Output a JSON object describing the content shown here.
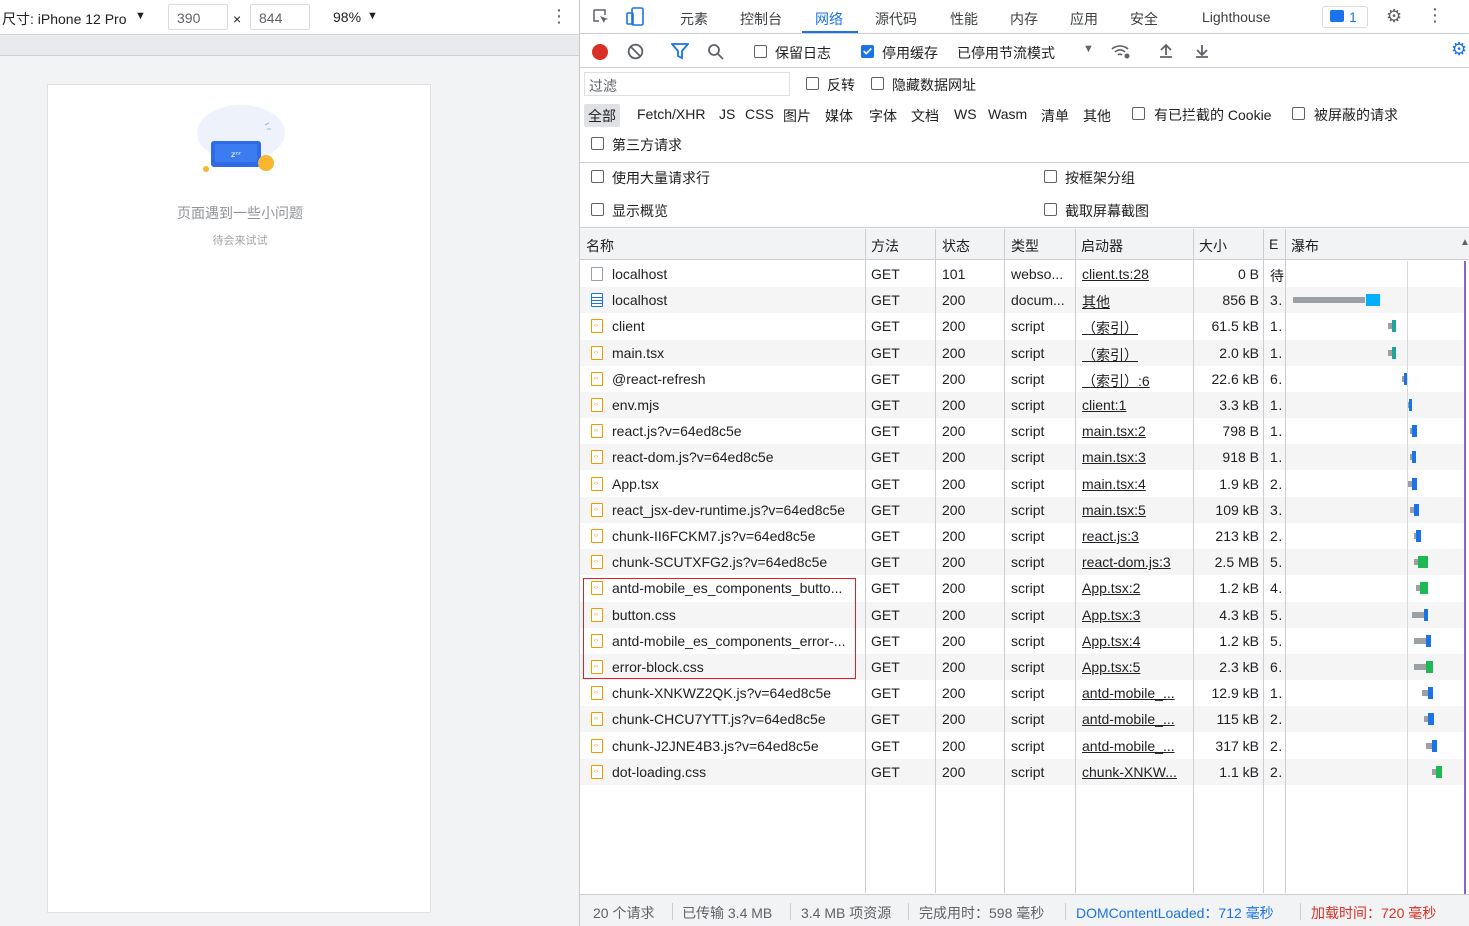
{
  "device_toolbar": {
    "dimension_label": "尺寸: iPhone 12 Pro",
    "width": "390",
    "times": "×",
    "height": "844",
    "zoom": "98%"
  },
  "phone_page": {
    "message": "页面遇到一些小问题",
    "sub_message": "待会来试试",
    "illustration_text": "zᶻᶻ"
  },
  "devtools_tabs": [
    "元素",
    "控制台",
    "网络",
    "源代码",
    "性能",
    "内存",
    "应用",
    "安全",
    "Lighthouse"
  ],
  "active_tab": "网络",
  "issues_count": "1",
  "network_toolbar": {
    "preserve_log": "保留日志",
    "disable_cache": "停用缓存",
    "throttling": "已停用节流模式"
  },
  "filter": {
    "placeholder": "过滤",
    "invert": "反转",
    "hide_data_urls": "隐藏数据网址"
  },
  "type_filters": [
    "全部",
    "Fetch/XHR",
    "JS",
    "CSS",
    "图片",
    "媒体",
    "字体",
    "文档",
    "WS",
    "Wasm",
    "清单",
    "其他"
  ],
  "blocked_cookies": "有已拦截的 Cookie",
  "blocked_requests": "被屏蔽的请求",
  "third_party": "第三方请求",
  "options": {
    "large_rows": "使用大量请求行",
    "group_by_frame": "按框架分组",
    "show_overview": "显示概览",
    "capture_screenshots": "截取屏幕截图"
  },
  "columns": [
    "名称",
    "方法",
    "状态",
    "类型",
    "启动器",
    "大小",
    "E",
    "瀑布"
  ],
  "requests": [
    {
      "name": "localhost",
      "method": "GET",
      "status": "101",
      "type": "webso...",
      "initiator": "client.ts:28",
      "size": "0 B",
      "time": "待",
      "icon": "blank"
    },
    {
      "name": "localhost",
      "method": "GET",
      "status": "200",
      "type": "docum...",
      "initiator": "其他",
      "size": "856 B",
      "time": "3..",
      "icon": "doc"
    },
    {
      "name": "client",
      "method": "GET",
      "status": "200",
      "type": "script",
      "initiator": "（索引）",
      "size": "61.5 kB",
      "time": "1..",
      "icon": "script"
    },
    {
      "name": "main.tsx",
      "method": "GET",
      "status": "200",
      "type": "script",
      "initiator": "（索引）",
      "size": "2.0 kB",
      "time": "1..",
      "icon": "script"
    },
    {
      "name": "@react-refresh",
      "method": "GET",
      "status": "200",
      "type": "script",
      "initiator": "（索引）:6",
      "size": "22.6 kB",
      "time": "6..",
      "icon": "script"
    },
    {
      "name": "env.mjs",
      "method": "GET",
      "status": "200",
      "type": "script",
      "initiator": "client:1",
      "size": "3.3 kB",
      "time": "1..",
      "icon": "script"
    },
    {
      "name": "react.js?v=64ed8c5e",
      "method": "GET",
      "status": "200",
      "type": "script",
      "initiator": "main.tsx:2",
      "size": "798 B",
      "time": "1..",
      "icon": "script"
    },
    {
      "name": "react-dom.js?v=64ed8c5e",
      "method": "GET",
      "status": "200",
      "type": "script",
      "initiator": "main.tsx:3",
      "size": "918 B",
      "time": "1..",
      "icon": "script"
    },
    {
      "name": "App.tsx",
      "method": "GET",
      "status": "200",
      "type": "script",
      "initiator": "main.tsx:4",
      "size": "1.9 kB",
      "time": "2..",
      "icon": "script"
    },
    {
      "name": "react_jsx-dev-runtime.js?v=64ed8c5e",
      "method": "GET",
      "status": "200",
      "type": "script",
      "initiator": "main.tsx:5",
      "size": "109 kB",
      "time": "3..",
      "icon": "script"
    },
    {
      "name": "chunk-II6FCKM7.js?v=64ed8c5e",
      "method": "GET",
      "status": "200",
      "type": "script",
      "initiator": "react.js:3",
      "size": "213 kB",
      "time": "2..",
      "icon": "script"
    },
    {
      "name": "chunk-SCUTXFG2.js?v=64ed8c5e",
      "method": "GET",
      "status": "200",
      "type": "script",
      "initiator": "react-dom.js:3",
      "size": "2.5 MB",
      "time": "5..",
      "icon": "script"
    },
    {
      "name": "antd-mobile_es_components_butto...",
      "method": "GET",
      "status": "200",
      "type": "script",
      "initiator": "App.tsx:2",
      "size": "1.2 kB",
      "time": "4..",
      "icon": "script"
    },
    {
      "name": "button.css",
      "method": "GET",
      "status": "200",
      "type": "script",
      "initiator": "App.tsx:3",
      "size": "4.3 kB",
      "time": "5..",
      "icon": "script"
    },
    {
      "name": "antd-mobile_es_components_error-...",
      "method": "GET",
      "status": "200",
      "type": "script",
      "initiator": "App.tsx:4",
      "size": "1.2 kB",
      "time": "5..",
      "icon": "script"
    },
    {
      "name": "error-block.css",
      "method": "GET",
      "status": "200",
      "type": "script",
      "initiator": "App.tsx:5",
      "size": "2.3 kB",
      "time": "6..",
      "icon": "script"
    },
    {
      "name": "chunk-XNKWZ2QK.js?v=64ed8c5e",
      "method": "GET",
      "status": "200",
      "type": "script",
      "initiator": "antd-mobile_...",
      "size": "12.9 kB",
      "time": "1..",
      "icon": "script"
    },
    {
      "name": "chunk-CHCU7YTT.js?v=64ed8c5e",
      "method": "GET",
      "status": "200",
      "type": "script",
      "initiator": "antd-mobile_...",
      "size": "115 kB",
      "time": "2..",
      "icon": "script"
    },
    {
      "name": "chunk-J2JNE4B3.js?v=64ed8c5e",
      "method": "GET",
      "status": "200",
      "type": "script",
      "initiator": "antd-mobile_...",
      "size": "317 kB",
      "time": "2..",
      "icon": "script"
    },
    {
      "name": "dot-loading.css",
      "method": "GET",
      "status": "200",
      "type": "script",
      "initiator": "chunk-XNKW...",
      "size": "1.1 kB",
      "time": "2..",
      "icon": "script"
    }
  ],
  "status_bar": {
    "requests": "20 个请求",
    "transferred": "已传输 3.4 MB",
    "resources": "3.4 MB 项资源",
    "finish": "完成用时：598 毫秒",
    "dcl": "DOMContentLoaded：712 毫秒",
    "load": "加载时间：720 毫秒"
  },
  "colors": {
    "accent": "#1a73e8",
    "dcl": "#1a73e8",
    "load": "#d93025",
    "highlight_box": "#e02020"
  }
}
